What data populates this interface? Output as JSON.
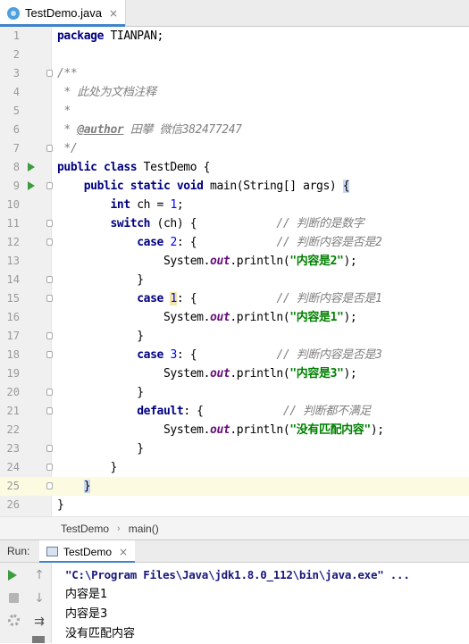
{
  "editor_tab": {
    "file_name": "TestDemo.java",
    "close_glyph": "×"
  },
  "code_lines": [
    {
      "n": "1",
      "text": "package TIANPAN;"
    },
    {
      "n": "2",
      "text": ""
    },
    {
      "n": "3",
      "text": "/**"
    },
    {
      "n": "4",
      "text": " * 此处为文档注释"
    },
    {
      "n": "5",
      "text": " *"
    },
    {
      "n": "6",
      "author_tag": "@author",
      "author_text": " 田攀 微信382477247"
    },
    {
      "n": "7",
      "text": " */"
    },
    {
      "n": "8",
      "text": "public class TestDemo {"
    },
    {
      "n": "9",
      "text": "public static void main(String[] args) {"
    },
    {
      "n": "10",
      "text": "int ch = 1;"
    },
    {
      "n": "11",
      "text": "switch (ch) {",
      "comment": "// 判断的是数字"
    },
    {
      "n": "12",
      "text": "case 2: {",
      "comment": "// 判断内容是否是2"
    },
    {
      "n": "13",
      "text": "System.out.println(\"内容是2\");"
    },
    {
      "n": "14",
      "text": "}"
    },
    {
      "n": "15",
      "text": "case 1: {",
      "comment": "// 判断内容是否是1"
    },
    {
      "n": "16",
      "text": "System.out.println(\"内容是1\");"
    },
    {
      "n": "17",
      "text": "}"
    },
    {
      "n": "18",
      "text": "case 3: {",
      "comment": "// 判断内容是否是3"
    },
    {
      "n": "19",
      "text": "System.out.println(\"内容是3\");"
    },
    {
      "n": "20",
      "text": "}"
    },
    {
      "n": "21",
      "text": "default: {",
      "comment": "// 判断都不满足"
    },
    {
      "n": "22",
      "text": "System.out.println(\"没有匹配内容\");"
    },
    {
      "n": "23",
      "text": "}"
    },
    {
      "n": "24",
      "text": "}"
    },
    {
      "n": "25",
      "text": "}"
    },
    {
      "n": "26",
      "text": "}"
    }
  ],
  "current_line": "25",
  "breadcrumb": {
    "class_name": "TestDemo",
    "separator": "›",
    "method_name": "main()"
  },
  "run_panel": {
    "label": "Run:",
    "tab_label": "TestDemo",
    "close_glyph": "×",
    "console_lines": [
      "\"C:\\Program Files\\Java\\jdk1.8.0_112\\bin\\java.exe\" ...",
      "内容是1",
      "内容是3",
      "没有匹配内容"
    ]
  },
  "icons": {
    "file_tab": "java-class-icon",
    "run_gutter": "run-arrow-icon",
    "toolbar": [
      "rerun-icon",
      "stop-icon",
      "settings-icon",
      "scroll-up-icon",
      "scroll-down-icon",
      "soft-wrap-icon",
      "print-icon"
    ]
  },
  "colors": {
    "keyword": "#000080",
    "string": "#008000",
    "comment": "#808080",
    "javadoc": "#629755",
    "number": "#0000ff",
    "field": "#660e7a",
    "current_line": "#fcfae1",
    "tab_underline": "#4083c9",
    "run_green": "#3e9b3e"
  }
}
